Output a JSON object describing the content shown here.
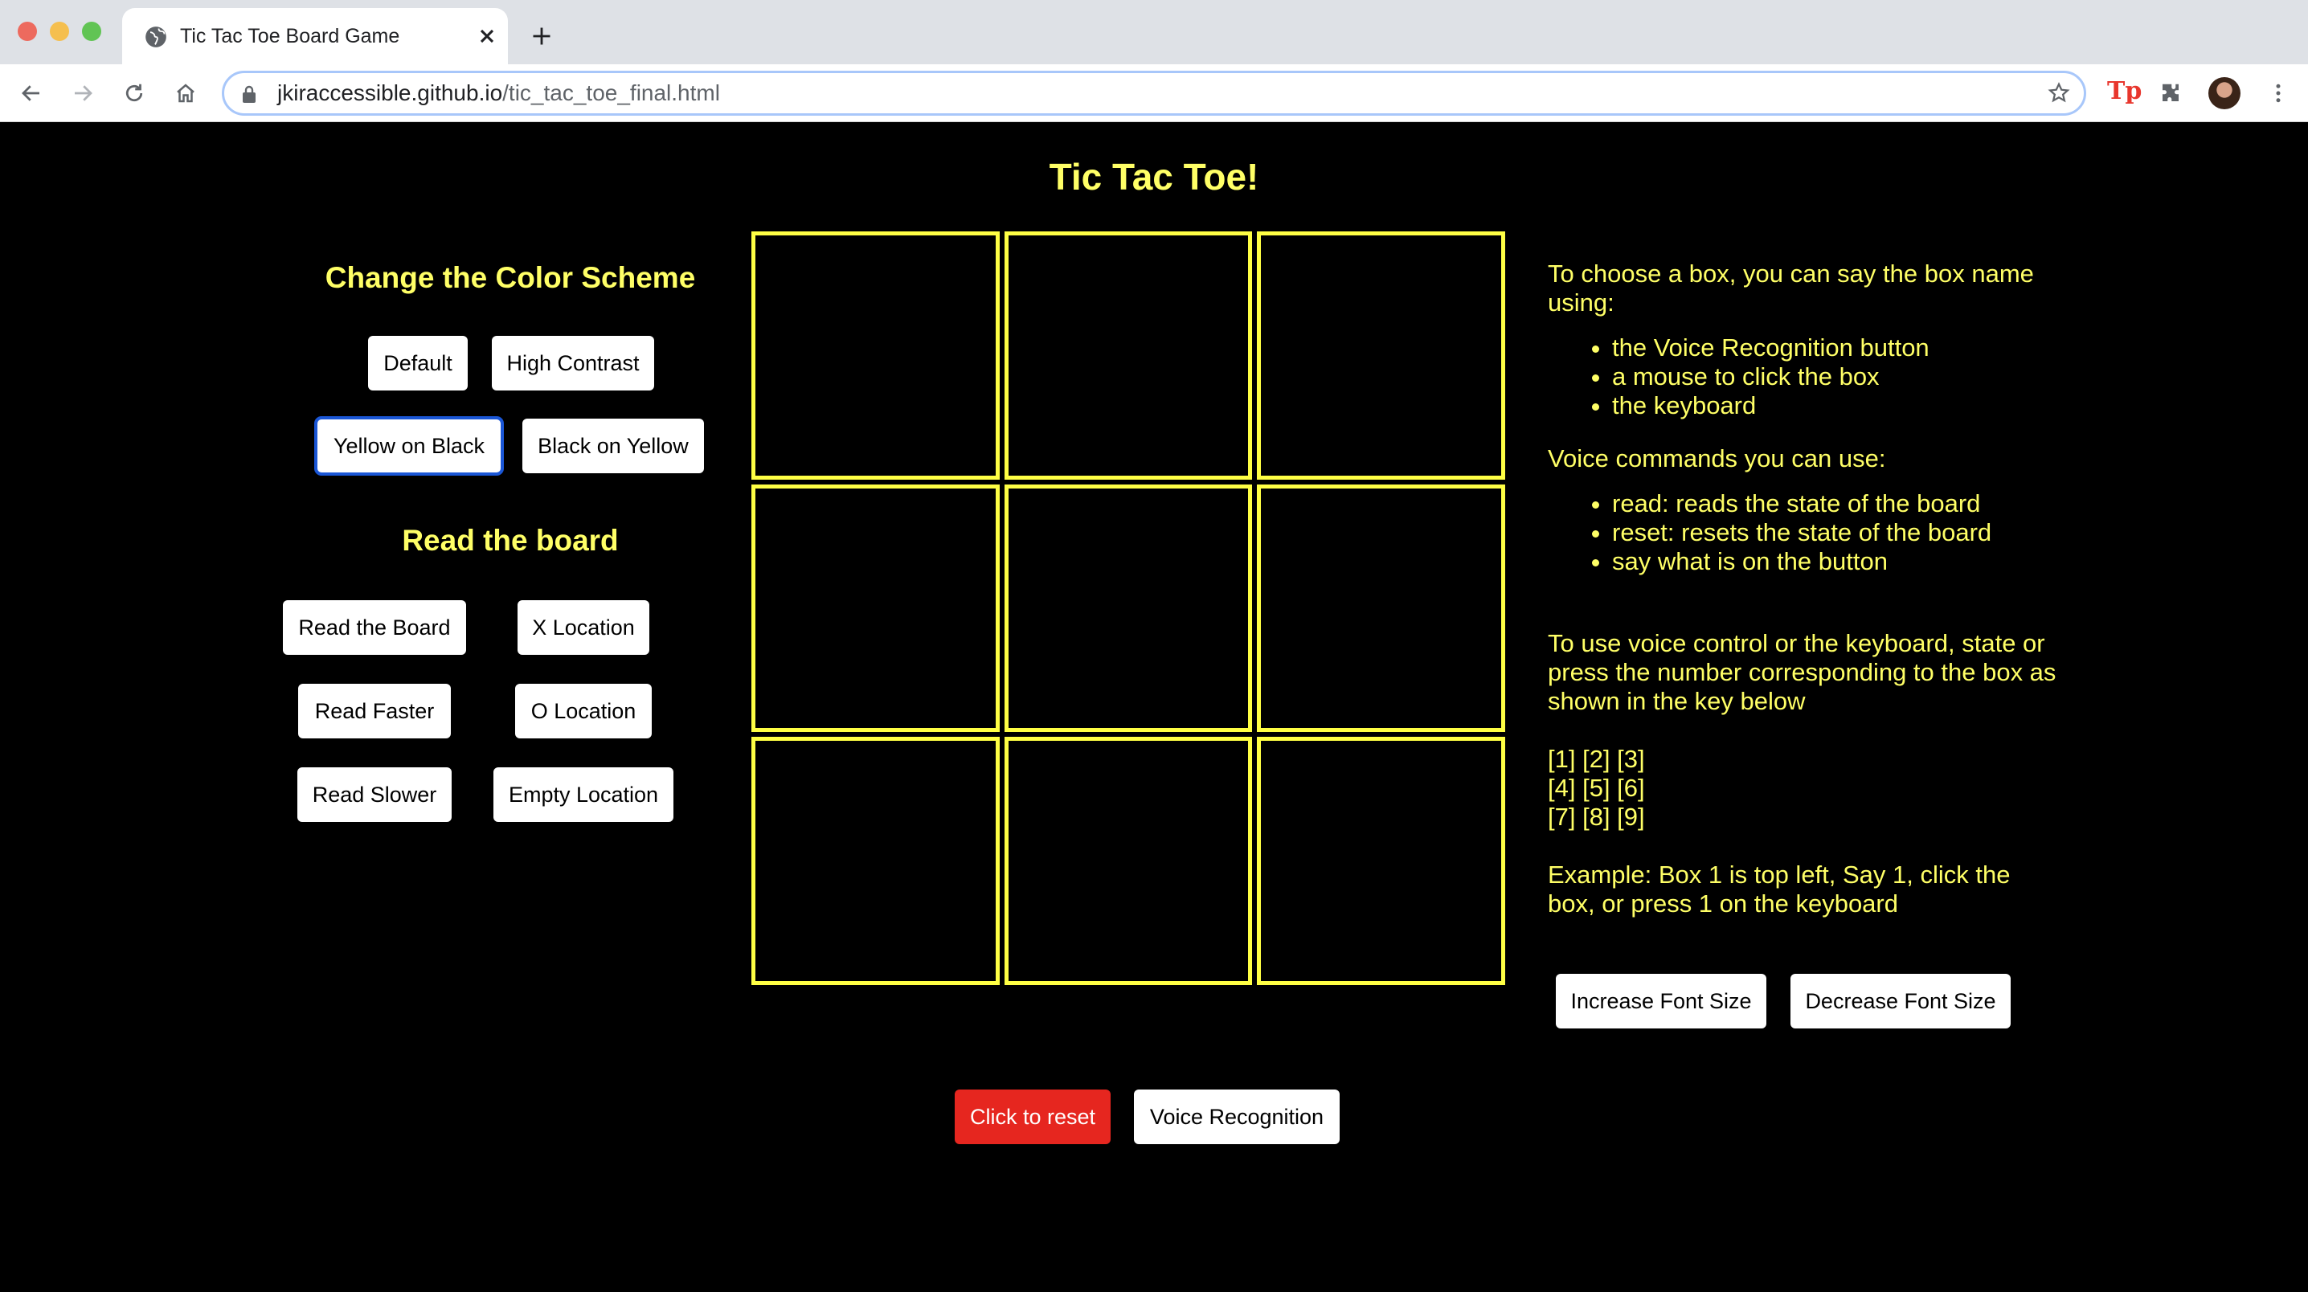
{
  "browser": {
    "tab_title": "Tic Tac Toe Board Game",
    "url_host": "jkiraccessible.github.io",
    "url_path": "/tic_tac_toe_final.html",
    "extension_label": "Tp"
  },
  "page": {
    "title": "Tic Tac Toe!",
    "color_scheme": {
      "heading": "Change the Color Scheme",
      "buttons": [
        "Default",
        "High Contrast",
        "Yellow on Black",
        "Black on Yellow"
      ],
      "selected": "Yellow on Black"
    },
    "read_board": {
      "heading": "Read the board",
      "buttons": [
        "Read the Board",
        "X Location",
        "Read Faster",
        "O Location",
        "Read Slower",
        "Empty Location"
      ]
    },
    "board": {
      "cells": [
        "",
        "",
        "",
        "",
        "",
        "",
        "",
        "",
        ""
      ]
    },
    "info": {
      "intro": "To choose a box, you can say the box name using:",
      "methods": [
        "the Voice Recognition button",
        "a mouse to click the box",
        "the keyboard"
      ],
      "commands_heading": "Voice commands you can use:",
      "commands": [
        "read: reads the state of the board",
        "reset: resets the state of the board",
        "say what is on the button"
      ],
      "keyboard_intro": "To use voice control or the keyboard, state or press the number corresponding to the box as shown in the key below",
      "key_rows": [
        "[1] [2] [3]",
        "[4] [5] [6]",
        "[7] [8] [9]"
      ],
      "example": "Example: Box 1 is top left, Say 1, click the box, or press 1 on the keyboard"
    },
    "font_buttons": {
      "increase": "Increase Font Size",
      "decrease": "Decrease Font Size"
    },
    "bottom_buttons": {
      "reset": "Click to reset",
      "voice": "Voice Recognition"
    },
    "colors": {
      "accent": "#ffff66",
      "board_line": "#ffff44",
      "reset": "#e6261f",
      "focus": "#1a56d6"
    }
  }
}
